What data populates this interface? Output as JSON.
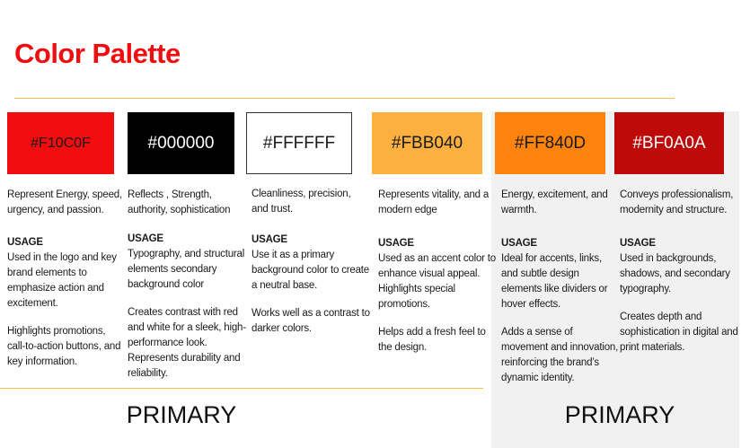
{
  "title": "Color Palette",
  "colors": {
    "accent": "#F10C0F",
    "rule": "#F5C04A",
    "panel": "#F1F1F1"
  },
  "columns": [
    {
      "hex": "#F10C0F",
      "swatch_color": "#F10C0F",
      "text_color": "#1a1a1a",
      "description": "Represent Energy, speed, urgency, and passion.",
      "usage_label": "USAGE",
      "usage": [
        "Used in the logo and key brand elements to emphasize action and excitement.",
        "Highlights promotions, call-to-action buttons, and key information."
      ]
    },
    {
      "hex": "#000000",
      "swatch_color": "#000000",
      "text_color": "#ffffff",
      "description": "Reflects , Strength, authority, sophistication",
      "usage_label": "USAGE",
      "usage": [
        "Typography, and structural elements secondary background color",
        "Creates contrast with red and white for a sleek, high-performance look. Represents durability and reliability."
      ]
    },
    {
      "hex": "#FFFFFF",
      "swatch_color": "#FFFFFF",
      "text_color": "#1a1a1a",
      "description": "Cleanliness, precision, and trust.",
      "usage_label": "USAGE",
      "usage": [
        "Use it as a primary background color to create a neutral base.",
        "Works well as a contrast to darker colors."
      ]
    },
    {
      "hex": "#FBB040",
      "swatch_color": "#FBB040",
      "text_color": "#1a1a1a",
      "description": "Represents vitality, and a modern edge",
      "usage_label": "USAGE",
      "usage": [
        "Used as an accent color to enhance visual appeal.",
        "Highlights special promotions.",
        "Helps add a fresh feel to the design."
      ]
    },
    {
      "hex": "#FF840D",
      "swatch_color": "#FF840D",
      "text_color": "#1a1a1a",
      "description": "Energy, excitement, and warmth.",
      "usage_label": "USAGE",
      "usage": [
        "Ideal for accents, links, and subtle design elements like dividers or hover effects.",
        "Adds a sense of movement and innovation, reinforcing the brand’s dynamic identity."
      ]
    },
    {
      "hex": "#BF0A0A",
      "swatch_color": "#BF0A0A",
      "text_color": "#ffffff",
      "description": "Conveys professionalism, modernity and structure.",
      "usage_label": "USAGE",
      "usage": [
        "Used in backgrounds, shadows, and secondary typography.",
        "Creates depth and sophistication in digital and print materials."
      ]
    }
  ],
  "group_labels": [
    "PRIMARY",
    "PRIMARY"
  ]
}
